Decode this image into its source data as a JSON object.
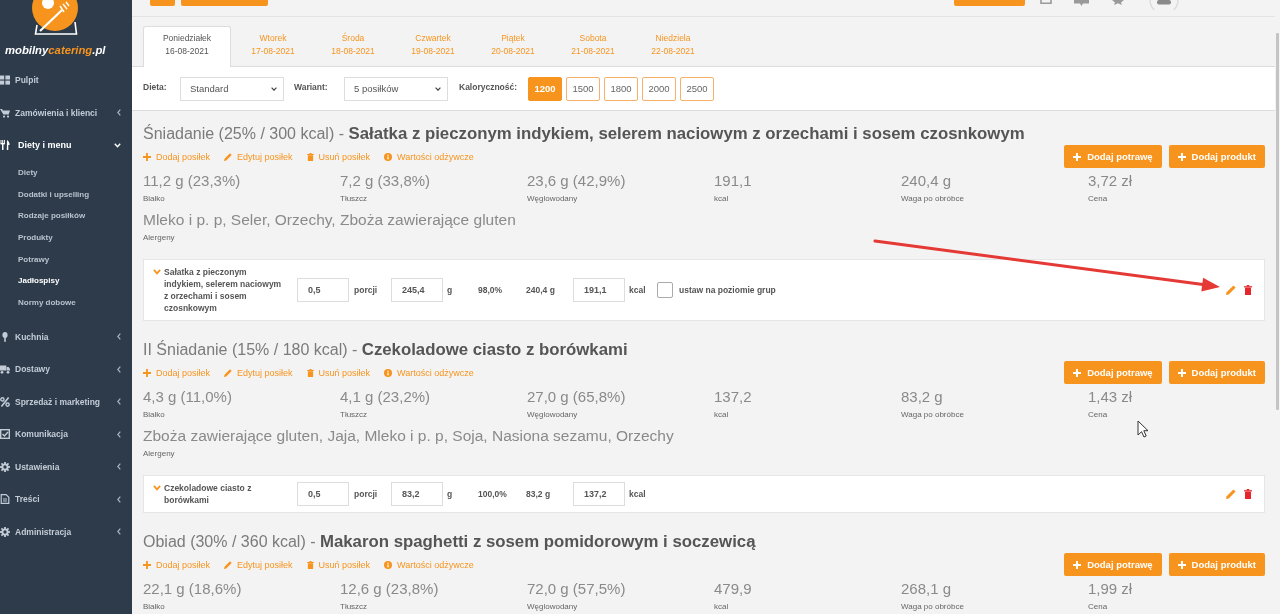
{
  "sidebar": {
    "logo": {
      "parts": [
        "mobilny",
        "catering",
        ".pl"
      ]
    },
    "items": [
      {
        "label": "Pulpit"
      },
      {
        "label": "Zamówienia i klienci",
        "expanded": false
      },
      {
        "label": "Diety i menu",
        "expanded": true,
        "children": [
          {
            "label": "Diety",
            "selected": false
          },
          {
            "label": "Dodatki i upselling",
            "selected": false
          },
          {
            "label": "Rodzaje posiłków",
            "selected": false
          },
          {
            "label": "Produkty",
            "selected": false
          },
          {
            "label": "Potrawy",
            "selected": false
          },
          {
            "label": "Jadłospisy",
            "selected": true
          },
          {
            "label": "Normy dobowe",
            "selected": false
          }
        ]
      },
      {
        "label": "Kuchnia",
        "expanded": false
      },
      {
        "label": "Dostawy",
        "expanded": false
      },
      {
        "label": "Sprzedaż i marketing",
        "expanded": false
      },
      {
        "label": "Komunikacja",
        "expanded": false
      },
      {
        "label": "Ustawienia",
        "expanded": false
      },
      {
        "label": "Treści",
        "expanded": false
      },
      {
        "label": "Administracja",
        "expanded": false
      }
    ]
  },
  "day_tabs": [
    {
      "day": "Poniedziałek",
      "date": "16-08-2021",
      "selected": true
    },
    {
      "day": "Wtorek",
      "date": "17-08-2021",
      "selected": false
    },
    {
      "day": "Środa",
      "date": "18-08-2021",
      "selected": false
    },
    {
      "day": "Czwartek",
      "date": "19-08-2021",
      "selected": false
    },
    {
      "day": "Piątek",
      "date": "20-08-2021",
      "selected": false
    },
    {
      "day": "Sobota",
      "date": "21-08-2021",
      "selected": false
    },
    {
      "day": "Niedziela",
      "date": "22-08-2021",
      "selected": false
    }
  ],
  "filters": {
    "diet": {
      "label": "Dieta:",
      "value": "Standard"
    },
    "variant": {
      "label": "Wariant:",
      "value": "5 posiłków"
    },
    "calories": {
      "label": "Kaloryczność:",
      "options": [
        {
          "label": "1200",
          "selected": true
        },
        {
          "label": "1500",
          "selected": false
        },
        {
          "label": "1800",
          "selected": false
        },
        {
          "label": "2000",
          "selected": false
        },
        {
          "label": "2500",
          "selected": false
        }
      ]
    }
  },
  "meals": [
    {
      "title": "Śniadanie (25% / 300 kcal) - **Sałatka z pieczonym indykiem, selerem naciowym z orzechami i sosem czosnkowym**",
      "actions": [
        {
          "kind": "add",
          "label": "Dodaj posiłek"
        },
        {
          "kind": "edit",
          "label": "Edytuj posiłek"
        },
        {
          "kind": "delete",
          "label": "Usuń posiłek"
        },
        {
          "kind": "info",
          "label": "Wartości odżywcze"
        }
      ],
      "buttons": [
        {
          "label": "Dodaj potrawę"
        },
        {
          "label": "Dodaj produkt"
        }
      ],
      "stats": [
        {
          "value": "11,2 g (23,3%)",
          "label": "Białko"
        },
        {
          "value": "7,2 g (33,8%)",
          "label": "Tłuszcz"
        },
        {
          "value": "23,6 g (42,9%)",
          "label": "Węglowodany"
        },
        {
          "value": "191,1",
          "label": "kcal"
        },
        {
          "value": "240,4 g",
          "label": "Waga po obróbce"
        },
        {
          "value": "3,72 zł",
          "label": "Cena"
        }
      ],
      "allergens": {
        "value": "Mleko i p. p, Seler, Orzechy, Zboża zawierające gluten",
        "label": "Alergeny"
      },
      "dishes": [
        {
          "name": "Sałatka z pieczonym indykiem, selerem naciowym z orzechami i sosem czosnkowym",
          "portions": {
            "value": "0,5",
            "unit": "porcji"
          },
          "weight": {
            "value": "245,4",
            "unit": "g"
          },
          "yield": "98,0%",
          "weight_after": "240,4 g",
          "kcal": {
            "value": "191,1",
            "unit": "kcal"
          },
          "group_level": {
            "label": "ustaw na poziomie grup",
            "checked": false
          }
        }
      ]
    },
    {
      "title": "II Śniadanie (15% / 180 kcal) - **Czekoladowe ciasto z borówkami**",
      "actions": [
        {
          "kind": "add",
          "label": "Dodaj posiłek"
        },
        {
          "kind": "edit",
          "label": "Edytuj posiłek"
        },
        {
          "kind": "delete",
          "label": "Usuń posiłek"
        },
        {
          "kind": "info",
          "label": "Wartości odżywcze"
        }
      ],
      "buttons": [
        {
          "label": "Dodaj potrawę"
        },
        {
          "label": "Dodaj produkt"
        }
      ],
      "stats": [
        {
          "value": "4,3 g (11,0%)",
          "label": "Białko"
        },
        {
          "value": "4,1 g (23,2%)",
          "label": "Tłuszcz"
        },
        {
          "value": "27,0 g (65,8%)",
          "label": "Węglowodany"
        },
        {
          "value": "137,2",
          "label": "kcal"
        },
        {
          "value": "83,2 g",
          "label": "Waga po obróbce"
        },
        {
          "value": "1,43 zł",
          "label": "Cena"
        }
      ],
      "allergens": {
        "value": "Zboża zawierające gluten, Jaja, Mleko i p. p, Soja, Nasiona sezamu, Orzechy",
        "label": "Alergeny"
      },
      "dishes": [
        {
          "name": "Czekoladowe ciasto z borówkami",
          "portions": {
            "value": "0,5",
            "unit": "porcji"
          },
          "weight": {
            "value": "83,2",
            "unit": "g"
          },
          "yield": "100,0%",
          "weight_after": "83,2 g",
          "kcal": {
            "value": "137,2",
            "unit": "kcal"
          }
        }
      ]
    },
    {
      "title": "Obiad (30% / 360 kcal) - **Makaron spaghetti z sosem pomidorowym i soczewicą**",
      "actions": [
        {
          "kind": "add",
          "label": "Dodaj posiłek"
        },
        {
          "kind": "edit",
          "label": "Edytuj posiłek"
        },
        {
          "kind": "delete",
          "label": "Usuń posiłek"
        },
        {
          "kind": "info",
          "label": "Wartości odżywcze"
        }
      ],
      "buttons": [
        {
          "label": "Dodaj potrawę"
        },
        {
          "label": "Dodaj produkt"
        }
      ],
      "stats": [
        {
          "value": "22,1 g (18,6%)",
          "label": "Białko"
        },
        {
          "value": "12,6 g (23,8%)",
          "label": "Tłuszcz"
        },
        {
          "value": "72,0 g (57,5%)",
          "label": "Węglowodany"
        },
        {
          "value": "479,9",
          "label": "kcal"
        },
        {
          "value": "268,1 g",
          "label": "Waga po obróbce"
        },
        {
          "value": "1,99 zł",
          "label": "Cena"
        }
      ]
    }
  ]
}
